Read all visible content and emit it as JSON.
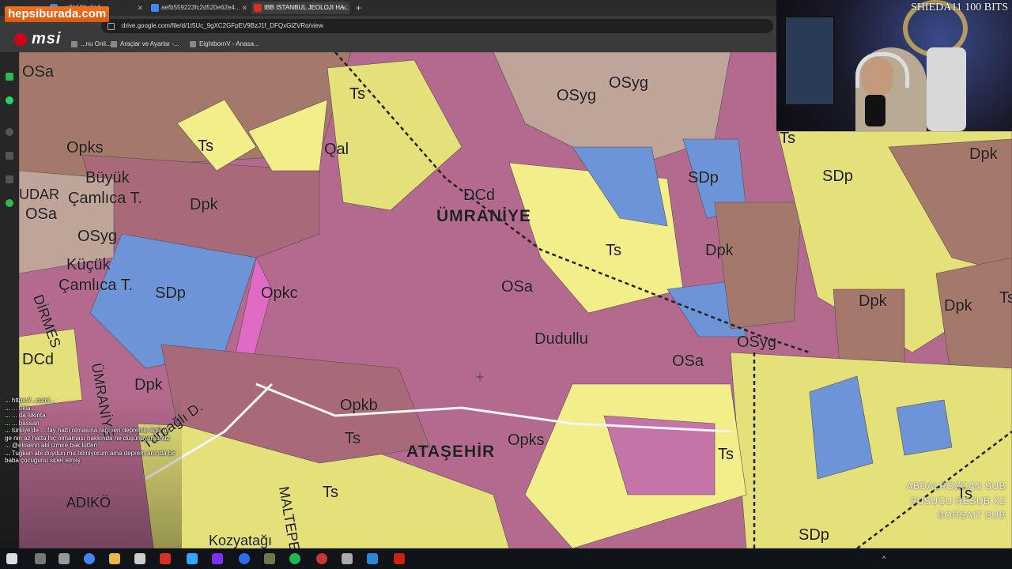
{
  "browser": {
    "tabs": [
      {
        "label": "...a2b520e6z4...",
        "active": false
      },
      {
        "label": "aefb559223fc2d520e62e4...",
        "active": false
      },
      {
        "label": "IBB ISTANBUL JEOLOJI HA...",
        "active": true
      }
    ],
    "new_tab_label": "+",
    "url": "drive.google.com/file/d/1t5Uc_9gXC2GFpEV9BzJ1f_DFQxGlZVRo/view",
    "bookmarks": [
      "...nu Onli...",
      "Araçlar ve Ayarlar -...",
      "EightbornV - Anasa..."
    ]
  },
  "overlay": {
    "brand": "hepsiburada.com",
    "msi": "msi"
  },
  "map": {
    "labels": [
      {
        "id": "osa-tl",
        "text": "OSa"
      },
      {
        "id": "ts-1",
        "text": "Ts"
      },
      {
        "id": "osyg-top",
        "text": "OSyg"
      },
      {
        "id": "osyg-top2",
        "text": "OSyg"
      },
      {
        "id": "opks-l",
        "text": "Opks"
      },
      {
        "id": "ts-2",
        "text": "Ts"
      },
      {
        "id": "qal",
        "text": "Qal"
      },
      {
        "id": "buyuk",
        "text": "Büyük"
      },
      {
        "id": "camlica",
        "text": "Çamlıca T."
      },
      {
        "id": "udar",
        "text": "UDAR"
      },
      {
        "id": "osa-l",
        "text": "OSa"
      },
      {
        "id": "dpk-1",
        "text": "Dpk"
      },
      {
        "id": "dcd-1",
        "text": "DCd"
      },
      {
        "id": "umraniye",
        "text": "ÜMRANİYE"
      },
      {
        "id": "sdp-top",
        "text": "SDp"
      },
      {
        "id": "osyg-l",
        "text": "OSyg"
      },
      {
        "id": "kucuk",
        "text": "Küçük"
      },
      {
        "id": "camlica2",
        "text": "Çamlıca T."
      },
      {
        "id": "sdp-l",
        "text": "SDp"
      },
      {
        "id": "opkc",
        "text": "Opkc"
      },
      {
        "id": "ts-3",
        "text": "Ts"
      },
      {
        "id": "dpk-r",
        "text": "Dpk"
      },
      {
        "id": "osa-c",
        "text": "OSa"
      },
      {
        "id": "dudullu",
        "text": "Dudullu"
      },
      {
        "id": "osyg-r",
        "text": "OSyg"
      },
      {
        "id": "osa-r",
        "text": "OSa"
      },
      {
        "id": "dcd-l",
        "text": "DCd"
      },
      {
        "id": "dpk-l2",
        "text": "Dpk"
      },
      {
        "id": "opkb",
        "text": "Opkb"
      },
      {
        "id": "ts-4",
        "text": "Ts"
      },
      {
        "id": "atasehir",
        "text": "ATAŞEHİR"
      },
      {
        "id": "opks-c",
        "text": "Opks"
      },
      {
        "id": "ts-5",
        "text": "Ts"
      },
      {
        "id": "ts-6",
        "text": "Ts"
      },
      {
        "id": "kozyatagi",
        "text": "Kozyatağı"
      },
      {
        "id": "dpk-fr",
        "text": "Dpk"
      },
      {
        "id": "sdp-fr",
        "text": "SDp"
      },
      {
        "id": "dpk-r2",
        "text": "Dpk"
      },
      {
        "id": "dpk-r3",
        "text": "Dpk"
      },
      {
        "id": "ts-r",
        "text": "Ts"
      },
      {
        "id": "sdp-br",
        "text": "SDp"
      },
      {
        "id": "ts-br",
        "text": "Ts"
      },
      {
        "id": "turbagli",
        "text": "Turbağlı D."
      },
      {
        "id": "umraniye-v",
        "text": "ÜMRANİYE"
      },
      {
        "id": "dirmes",
        "text": "DİRMES"
      },
      {
        "id": "maltepe",
        "text": "MALTEPE"
      },
      {
        "id": "kadikoy",
        "text": "ADIKÖ"
      },
      {
        "id": "ts-far",
        "text": "Ts"
      }
    ],
    "colors": {
      "purple": "#b46a8e",
      "mauve": "#a86a78",
      "pink": "#c474a6",
      "yellow": "#e4e07a",
      "brightyellow": "#f2ef8a",
      "blue": "#6c94d6",
      "brown": "#a4786a",
      "tan": "#bfa49a",
      "magenta": "#e06ac4"
    }
  },
  "chat": [
    {
      "name": "...",
      "text": "https://...com/...",
      "first": true
    },
    {
      "name": "...",
      "text": "... tıkla ..."
    },
    {
      "name": "...",
      "text": "... da sikinta"
    },
    {
      "name": "...",
      "text": "... bassan"
    },
    {
      "name": "...",
      "text": "türkiye'de ... fay hattı olmasına rağmen depremle ilgili ar-ge nin az hatta hiç olmaması hakkında ne düşünüyorsunuz"
    },
    {
      "name": "...",
      "text": "@elraenn abi izmire bak lütfen"
    },
    {
      "name": "...",
      "text": "Tuğkan abi duydun mu bilmiyorum ama deprem anında bir baba çocuğunu siper etmiş"
    }
  ],
  "subs": [
    "ABDALROZCAN SUB",
    "FUSUCU RESUB X2",
    "BORSAIT SUB"
  ],
  "tray": "^",
  "bits": "SHIEDA11 100 BITS"
}
